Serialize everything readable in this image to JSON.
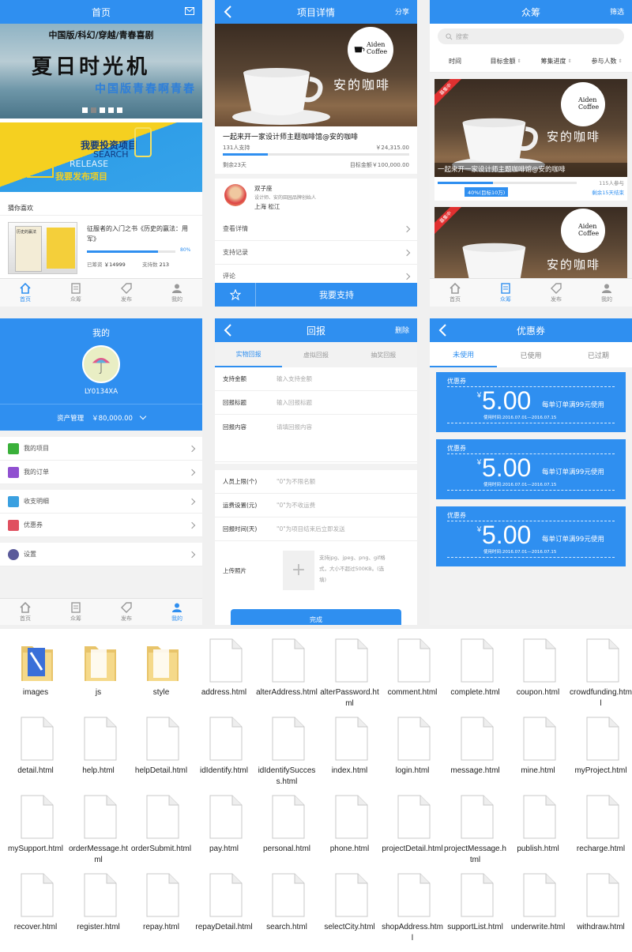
{
  "colors": {
    "primary": "#2f8ff0",
    "background": "#f0f0f0"
  },
  "tabbar": {
    "home": "首页",
    "crowd": "众筹",
    "publish": "发布",
    "mine": "我的"
  },
  "home": {
    "title": "首页",
    "banner_line1": "中国版/科幻/穿越/青春喜剧",
    "banner_line2": "夏日时光机",
    "banner_line3": "中国版青春啊青春",
    "ad_invest": "我要投资项目",
    "ad_invest_en": "SEARCH",
    "ad_publish_en": "RELEASE",
    "ad_publish": "我要发布项目",
    "guess_title": "猜你喜欢",
    "book_title": "征服者的入门之书《历史的赢法：用军》",
    "book_cover": "历史的赢法",
    "progress_pct": "80%",
    "progress": 0.8,
    "raised_label": "已筹资",
    "raised": "￥14999",
    "supporters_label": "支持数",
    "supporters": "213"
  },
  "detail": {
    "title": "项目详情",
    "share": "分享",
    "brand_en": "Aiden Coffee",
    "brand_cn": "安的咖啡",
    "project_title": "一起来开一家设计师主题咖啡馆@安的咖啡",
    "supporters": "131人支持",
    "amount": "￥24,315.00",
    "progress": 0.24,
    "days_left": "剩余23天",
    "target": "目标金额￥100,000.00",
    "author": "双子座",
    "author_desc": "设计师、安的田园品牌创始人",
    "location": "上海 松江",
    "menu": [
      "查看详情",
      "支持记录",
      "评论"
    ],
    "support_button": "我要支持"
  },
  "crowd": {
    "title": "众筹",
    "filter": "筛选",
    "search_placeholder": "搜索",
    "sorts": [
      "时间",
      "目标金额",
      "筹集进度",
      "参与人数"
    ],
    "badge": "募集中",
    "card_title": "一起来开一家设计师主题咖啡馆@安的咖啡",
    "participants": "115人参与",
    "progress": 0.4,
    "progress_label": "40%(目标10万)",
    "remaining": "剩余15天结束"
  },
  "mine": {
    "title": "我的",
    "username": "LY0134XA",
    "asset_label": "资产管理",
    "asset_value": "￥80,000.00",
    "items": [
      "我的项目",
      "我的订单",
      "收支明细",
      "优惠券",
      "设置"
    ]
  },
  "repay": {
    "title": "回报",
    "delete": "删除",
    "tabs": [
      "实物回报",
      "虚拟回报",
      "抽奖回报"
    ],
    "fields": [
      {
        "label": "支持金额",
        "placeholder": "输入支持金额"
      },
      {
        "label": "回报标题",
        "placeholder": "输入回报标题"
      },
      {
        "label": "回报内容",
        "placeholder": "请填回报内容"
      }
    ],
    "fields2": [
      {
        "label": "人员上限(个)",
        "placeholder": "\"0\"为不限名额"
      },
      {
        "label": "运费设置(元)",
        "placeholder": "\"0\"为不收运费"
      },
      {
        "label": "回报时间(天)",
        "placeholder": "\"0\"为项目结束后立即发送"
      }
    ],
    "photo_label": "上传照片",
    "photo_hint": "支持jpg、jpeg、png、gif格式，大小不超过500KB。(选填)",
    "done_button": "完成"
  },
  "coupon": {
    "title": "优惠券",
    "tabs": [
      "未使用",
      "已使用",
      "已过期"
    ],
    "items": [
      {
        "label": "优惠券",
        "yen": "￥",
        "amount": "5.00",
        "condition": "每单订单满99元使用",
        "date": "使用时间:2016.07.01—2016.07.15"
      },
      {
        "label": "优惠券",
        "yen": "￥",
        "amount": "5.00",
        "condition": "每单订单满99元使用",
        "date": "使用时间:2016.07.01—2016.07.15"
      },
      {
        "label": "优惠券",
        "yen": "￥",
        "amount": "5.00",
        "condition": "每单订单满99元使用",
        "date": "使用时间:2016.07.01—2016.07.15"
      }
    ]
  },
  "files": [
    {
      "name": "images",
      "type": "folder-img"
    },
    {
      "name": "js",
      "type": "folder"
    },
    {
      "name": "style",
      "type": "folder"
    },
    {
      "name": "address.html",
      "type": "file"
    },
    {
      "name": "alterAddress.html",
      "type": "file"
    },
    {
      "name": "alterPassword.html",
      "type": "file"
    },
    {
      "name": "comment.html",
      "type": "file"
    },
    {
      "name": "complete.html",
      "type": "file"
    },
    {
      "name": "coupon.html",
      "type": "file"
    },
    {
      "name": "crowdfunding.html",
      "type": "file"
    },
    {
      "name": "detail.html",
      "type": "file"
    },
    {
      "name": "help.html",
      "type": "file"
    },
    {
      "name": "helpDetail.html",
      "type": "file"
    },
    {
      "name": "idIdentify.html",
      "type": "file"
    },
    {
      "name": "idIdentifySuccess.html",
      "type": "file"
    },
    {
      "name": "index.html",
      "type": "file"
    },
    {
      "name": "login.html",
      "type": "file"
    },
    {
      "name": "message.html",
      "type": "file"
    },
    {
      "name": "mine.html",
      "type": "file"
    },
    {
      "name": "myProject.html",
      "type": "file"
    },
    {
      "name": "mySupport.html",
      "type": "file"
    },
    {
      "name": "orderMessage.html",
      "type": "file"
    },
    {
      "name": "orderSubmit.html",
      "type": "file"
    },
    {
      "name": "pay.html",
      "type": "file"
    },
    {
      "name": "personal.html",
      "type": "file"
    },
    {
      "name": "phone.html",
      "type": "file"
    },
    {
      "name": "projectDetail.html",
      "type": "file"
    },
    {
      "name": "projectMessage.html",
      "type": "file"
    },
    {
      "name": "publish.html",
      "type": "file"
    },
    {
      "name": "recharge.html",
      "type": "file"
    },
    {
      "name": "recover.html",
      "type": "file"
    },
    {
      "name": "register.html",
      "type": "file"
    },
    {
      "name": "repay.html",
      "type": "file"
    },
    {
      "name": "repayDetail.html",
      "type": "file"
    },
    {
      "name": "search.html",
      "type": "file"
    },
    {
      "name": "selectCity.html",
      "type": "file"
    },
    {
      "name": "shopAddress.html",
      "type": "file"
    },
    {
      "name": "supportList.html",
      "type": "file"
    },
    {
      "name": "underwrite.html",
      "type": "file"
    },
    {
      "name": "withdraw.html",
      "type": "file"
    }
  ]
}
